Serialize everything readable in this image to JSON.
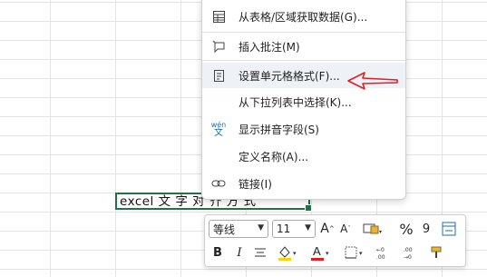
{
  "menu": {
    "items": [
      {
        "label": "从表格/区域获取数据(G)...",
        "icon": "table-icon"
      },
      {
        "label": "插入批注(M)",
        "icon": "comment-icon"
      },
      {
        "label": "设置单元格格式(F)...",
        "icon": "format-cells-icon"
      },
      {
        "label": "从下拉列表中选择(K)...",
        "icon": ""
      },
      {
        "label": "显示拼音字段(S)",
        "icon": "phonetic-icon"
      },
      {
        "label": "定义名称(A)...",
        "icon": ""
      },
      {
        "label": "链接(I)",
        "icon": "link-icon"
      }
    ],
    "phonetic_icon_text": "wén",
    "phonetic_icon_char": "文"
  },
  "cell": {
    "text": "excel  文  字  对  齐  方  式"
  },
  "mini_toolbar": {
    "font_name": "等线",
    "font_size": "11",
    "bold": "B",
    "italic": "I",
    "percent": "%",
    "comma": "9",
    "font_color_glyph": "A",
    "highlight_color": "#ffd200",
    "font_color": "#e02020"
  },
  "annotation": {
    "arrow_color": "#e02020"
  }
}
